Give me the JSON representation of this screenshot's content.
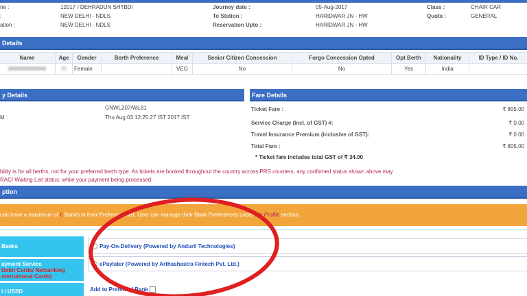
{
  "journey": {
    "rows": [
      {
        "l1": "ne :",
        "v1": "12017 / DEHRADUN SHTBDI",
        "l2": "Journey date :",
        "v2": "05-Aug-2017",
        "l3": "Class :",
        "v3": "CHAIR CAR"
      },
      {
        "l1": ":",
        "v1": "NEW DELHI - NDLS",
        "l2": "To Station :",
        "v2": "HARIDWAR JN - HW",
        "l3": "Quota :",
        "v3": "GENERAL"
      },
      {
        "l1": "ation :",
        "v1": "NEW DELHI - NDLS",
        "l2": "Reservation Upto :",
        "v2": "HARIDWAR JN - HW"
      }
    ]
  },
  "passenger": {
    "title": "Details",
    "headers": [
      "Name",
      "Age",
      "Gender",
      "Berth Preference",
      "Meal",
      "Senior Citizen Concession",
      "Forgo Concession Opted",
      "Opt Berth",
      "Nationality",
      "ID Type / ID No."
    ],
    "row": [
      "",
      "",
      "Female",
      "",
      "VEG",
      "No",
      "No",
      "Yes",
      "India",
      ""
    ]
  },
  "availability": {
    "title": "y Details",
    "rows": [
      {
        "label": "",
        "value": "GNWL207/WL81"
      },
      {
        "label": "M :",
        "value": "Thu Aug 03 12:25:27 IST 2017 IST"
      }
    ]
  },
  "fare": {
    "title": "Fare Details",
    "rows": [
      {
        "label": "Ticket Fare :",
        "value": "₹ 805.00"
      },
      {
        "label": "Service Charge (Incl. of GST) #:",
        "value": "₹ 0.00"
      },
      {
        "label": "Travel Insurance Premium (inclusive of GST):",
        "value": "₹ 0.00"
      },
      {
        "label": "Total Fare :",
        "value": "₹ 805.00"
      }
    ],
    "gst_note": "* Ticket fare includes total GST of ₹ 34.00"
  },
  "notice": [
    "bility is for all berths, not for your preferred berth type. As tickets are booked throughout the country across PRS counters, any confirmed status shown above may",
    "RAC/ Waiting List status, while your payment being processed."
  ],
  "payment": {
    "title": "ption",
    "info_pre": "can have a maximum of ",
    "info_num": "6",
    "info_mid": " Banks in their Preference list. User can manage their Bank Preferences under ",
    "info_link": "My Profile",
    "info_post": " section.",
    "left": [
      {
        "line1": "Banks"
      },
      {
        "line1": "ayment Service",
        "line2": "Debit Cards/ Netbanking",
        "line3": "nternational Cards)"
      },
      {
        "line1": "I / USSD"
      }
    ],
    "options": [
      "Pay-On-Delivery (Powered by Anduril Technologies)",
      "ePaylater (Powered by Arthashastra Fintech Pvt. Ltd.)"
    ],
    "add_pref": "Add to Preferred Bank"
  },
  "colors": {
    "header": "#3a6fc4",
    "orange": "#f2a53b",
    "cyan": "#35c4f0",
    "annotation": "#e02020"
  }
}
